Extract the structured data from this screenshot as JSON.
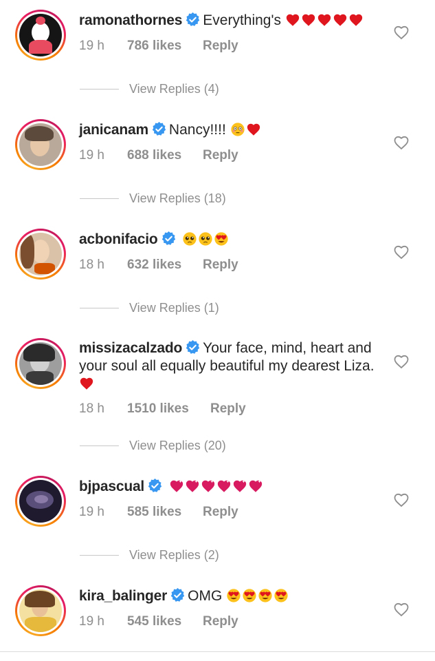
{
  "comments": [
    {
      "username": "ramonathornes",
      "text": "Everything's",
      "emojis": [
        "red-heart",
        "red-heart",
        "red-heart",
        "red-heart",
        "red-heart"
      ],
      "time": "19 h",
      "likes": "786 likes",
      "reply": "Reply",
      "view_replies": "View Replies (4)",
      "avatar_colors": [
        "#1a1a1a",
        "#e84a5f"
      ]
    },
    {
      "username": "janicanam",
      "text": "Nancy!!!!",
      "emojis": [
        "flushed-face",
        "red-heart"
      ],
      "time": "19 h",
      "likes": "688 likes",
      "reply": "Reply",
      "view_replies": "View Replies (18)",
      "avatar_colors": [
        "#b8a99a",
        "#5c4a3d"
      ]
    },
    {
      "username": "acbonifacio",
      "text": "",
      "emojis": [
        "pleading-face",
        "pleading-face",
        "heart-eyes-face"
      ],
      "time": "18 h",
      "likes": "632 likes",
      "reply": "Reply",
      "view_replies": "View Replies (1)",
      "avatar_colors": [
        "#d9c2a8",
        "#7a4e2e"
      ]
    },
    {
      "username": "missizacalzado",
      "text": "Your face, mind, heart and your soul all equally beautiful my dearest Liza.",
      "emojis": [
        "red-heart"
      ],
      "time": "18 h",
      "likes": "1510 likes",
      "reply": "Reply",
      "view_replies": "View Replies (20)",
      "avatar_colors": [
        "#9e9e9e",
        "#2b2b2b"
      ]
    },
    {
      "username": "bjpascual",
      "text": "",
      "emojis": [
        "sparkling-heart",
        "sparkling-heart",
        "sparkling-heart",
        "sparkling-heart",
        "sparkling-heart",
        "sparkling-heart"
      ],
      "time": "19 h",
      "likes": "585 likes",
      "reply": "Reply",
      "view_replies": "View Replies (2)",
      "avatar_colors": [
        "#5a4f7a",
        "#1f1a2e"
      ]
    },
    {
      "username": "kira_balinger",
      "text": "OMG",
      "emojis": [
        "heart-eyes-face",
        "heart-eyes-face",
        "heart-eyes-face",
        "heart-eyes-face"
      ],
      "time": "19 h",
      "likes": "545 likes",
      "reply": "Reply",
      "view_replies": "",
      "avatar_colors": [
        "#e6b93d",
        "#8a6a1c"
      ]
    }
  ],
  "colors": {
    "text": "#262626",
    "muted": "#8e8e8e",
    "verified": "#3897f0",
    "heart": "#e0161f"
  }
}
